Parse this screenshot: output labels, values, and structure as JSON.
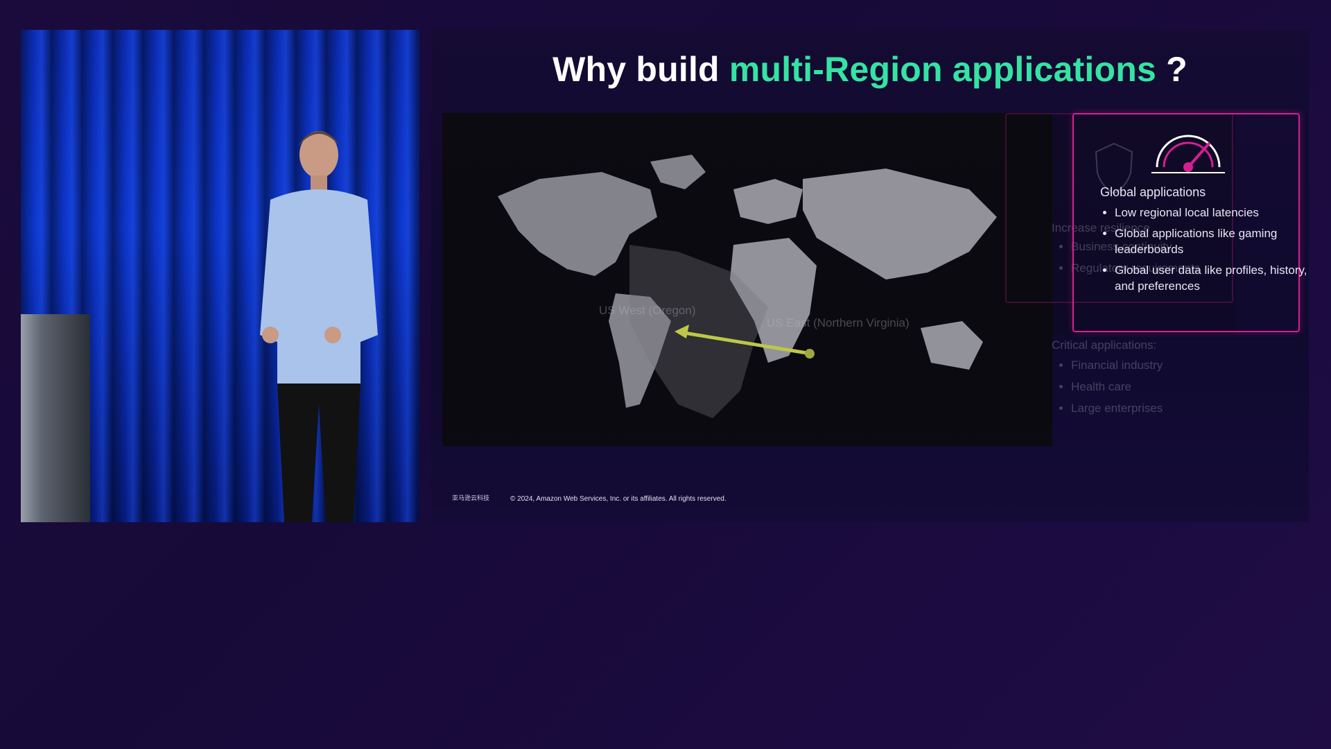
{
  "slide": {
    "title_prefix": "Why build ",
    "title_highlight": "multi-Region applications",
    "title_suffix": " ?",
    "card": {
      "title": "Global applications",
      "bullets": [
        "Low regional local latencies",
        "Global applications like gaming leaderboards",
        "Global user data like profiles, history, and preferences"
      ]
    },
    "ghost_top": {
      "title": "Increase resilience",
      "bullets": [
        "Business continuity",
        "Regulatory requirements"
      ]
    },
    "ghost_bottom": {
      "title": "Critical applications:",
      "bullets": [
        "Financial industry",
        "Health care",
        "Large enterprises"
      ]
    },
    "map_labels": {
      "west": "US West (Oregon)",
      "east": "US East (Northern Virginia)"
    },
    "footer": {
      "logo": "亚马逊云科技",
      "copyright": "© 2024, Amazon Web Services, Inc. or its affiliates. All rights reserved."
    },
    "colors": {
      "highlight": "#35e3a3",
      "card_border": "#d61f8f",
      "route_line": "#c8d24a"
    },
    "icons": [
      "speedometer-icon",
      "shield-icon"
    ]
  }
}
